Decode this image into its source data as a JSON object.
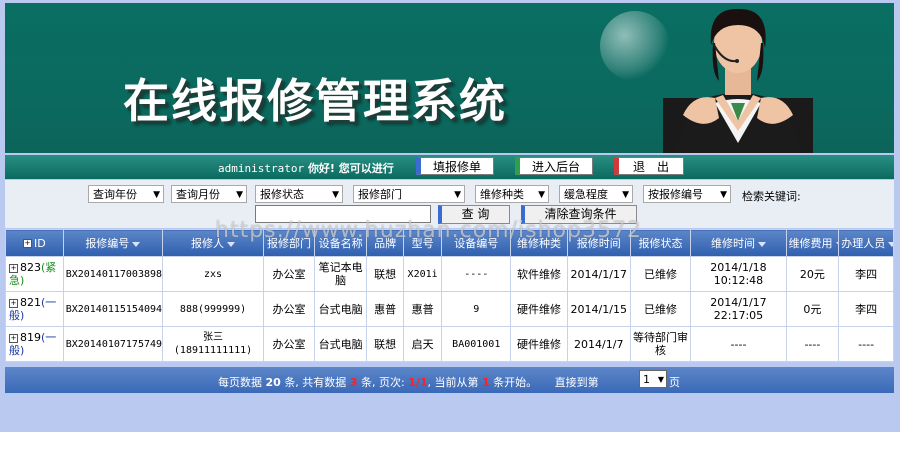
{
  "banner": {
    "title": "在线报修管理系统"
  },
  "navbar": {
    "greeting_user": "administrator",
    "greeting_text": "你好! 您可以进行",
    "btn_fill": "填报修单",
    "btn_backend": "进入后台",
    "btn_logout": "退　出"
  },
  "filters": {
    "year": "查询年份",
    "month": "查询月份",
    "status": "报修状态",
    "dept": "报修部门",
    "type": "维修种类",
    "urgency": "缓急程度",
    "by_no": "按报修编号",
    "keyword_label": "检索关键词:",
    "keyword_value": "",
    "query_btn": "查 询",
    "clear_btn": "清除查询条件"
  },
  "table": {
    "columns": [
      "ID",
      "报修编号",
      "报修人",
      "报修部门",
      "设备名称",
      "品牌",
      "型号",
      "设备编号",
      "维修种类",
      "报修时间",
      "报修状态",
      "维修时间",
      "维修费用",
      "办理人员"
    ],
    "rows": [
      {
        "id": "823",
        "urgency": "(紧急)",
        "no": "BX20140117003898",
        "reporter": "zxs",
        "dept": "办公室",
        "device": "笔记本电脑",
        "brand": "联想",
        "model": "X201i",
        "dev_no": "----",
        "type": "软件维修",
        "date": "2014/1/17",
        "status": "已维修",
        "fix_time": "2014/1/18 10:12:48",
        "fee": "20元",
        "handler": "李四"
      },
      {
        "id": "821",
        "urgency": "(一般)",
        "no": "BX20140115154094",
        "reporter": "888(999999)",
        "dept": "办公室",
        "device": "台式电脑",
        "brand": "惠普",
        "model": "惠普",
        "dev_no": "9",
        "type": "硬件维修",
        "date": "2014/1/15",
        "status": "已维修",
        "fix_time": "2014/1/17 22:17:05",
        "fee": "0元",
        "handler": "李四"
      },
      {
        "id": "819",
        "urgency": "(一般)",
        "no": "BX20140107175749",
        "reporter": "张三 (18911111111)",
        "dept": "办公室",
        "device": "台式电脑",
        "brand": "联想",
        "model": "启天",
        "dev_no": "BA001001",
        "type": "硬件维修",
        "date": "2014/1/7",
        "status": "等待部门审核",
        "fix_time": "----",
        "fee": "----",
        "handler": "----"
      }
    ]
  },
  "footer": {
    "t1": "每页数据",
    "per_page": "20",
    "t2": "条, 共有数据",
    "total": "3",
    "t3": "条, 页次:",
    "pages": "1/1",
    "t4": ", 当前从第",
    "start": "1",
    "t5": "条开始。",
    "goto_label": "直接到第",
    "goto_value": "1",
    "goto_suffix": "页"
  },
  "watermark": "https://www.huzhan.com/ishop3572"
}
